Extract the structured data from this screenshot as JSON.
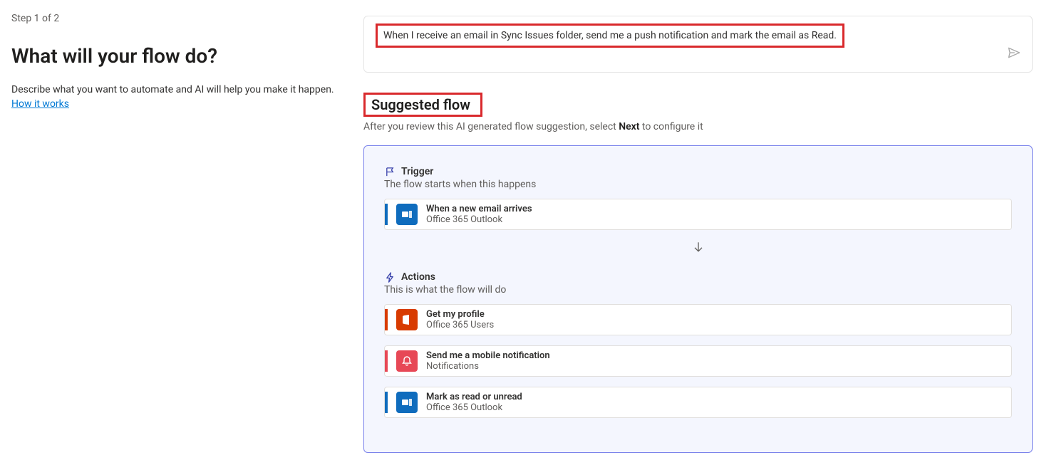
{
  "left": {
    "step": "Step 1 of 2",
    "title": "What will your flow do?",
    "desc": "Describe what you want to automate and AI will help you make it happen.",
    "link": "How it works"
  },
  "prompt": {
    "text": "When I receive an email in Sync Issues folder, send me a push notification and mark the email as Read."
  },
  "suggested": {
    "title": "Suggested flow",
    "desc_pre": "After you review this AI generated flow suggestion, select ",
    "desc_bold": "Next",
    "desc_post": " to configure it"
  },
  "trigger_section": {
    "label": "Trigger",
    "sub": "The flow starts when this happens",
    "card": {
      "title": "When a new email arrives",
      "sub": "Office 365 Outlook",
      "accent": "accent-blue",
      "icon": "icon-blue",
      "glyph": "outlook"
    }
  },
  "actions_section": {
    "label": "Actions",
    "sub": "This is what the flow will do",
    "cards": [
      {
        "title": "Get my profile",
        "sub": "Office 365 Users",
        "accent": "accent-orange",
        "icon": "icon-orange",
        "glyph": "office"
      },
      {
        "title": "Send me a mobile notification",
        "sub": "Notifications",
        "accent": "accent-red",
        "icon": "icon-red",
        "glyph": "bell"
      },
      {
        "title": "Mark as read or unread",
        "sub": "Office 365 Outlook",
        "accent": "accent-blue",
        "icon": "icon-blue",
        "glyph": "outlook"
      }
    ]
  }
}
